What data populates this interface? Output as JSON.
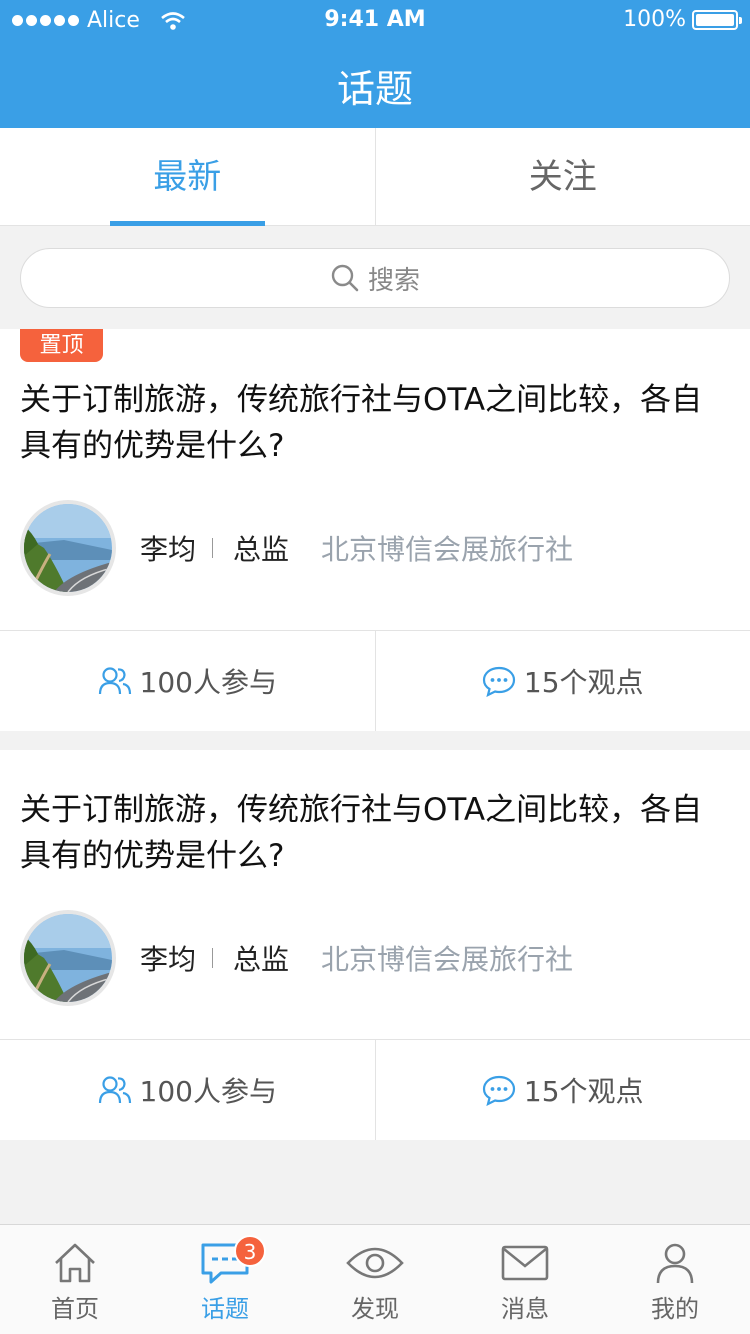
{
  "status_bar": {
    "carrier": "Alice",
    "time": "9:41 AM",
    "battery": "100%"
  },
  "nav": {
    "title": "话题"
  },
  "tabs": [
    {
      "label": "最新",
      "active": true
    },
    {
      "label": "关注",
      "active": false
    }
  ],
  "search": {
    "placeholder": "搜索"
  },
  "posts": [
    {
      "pinned_label": "置顶",
      "title": "关于订制旅游，传统旅行社与OTA之间比较，各自具有的优势是什么?",
      "author": {
        "name": "李均",
        "role": "总监",
        "company": "北京博信会展旅行社"
      },
      "participants": "100人参与",
      "opinions": "15个观点"
    },
    {
      "title": "关于订制旅游，传统旅行社与OTA之间比较，各自具有的优势是什么?",
      "author": {
        "name": "李均",
        "role": "总监",
        "company": "北京博信会展旅行社"
      },
      "participants": "100人参与",
      "opinions": "15个观点"
    }
  ],
  "tabbar": {
    "items": [
      {
        "label": "首页",
        "icon": "home-icon"
      },
      {
        "label": "话题",
        "icon": "chat-icon",
        "active": true,
        "badge": "3"
      },
      {
        "label": "发现",
        "icon": "eye-icon"
      },
      {
        "label": "消息",
        "icon": "mail-icon"
      },
      {
        "label": "我的",
        "icon": "user-icon"
      }
    ]
  },
  "colors": {
    "primary": "#3a9fe6",
    "accent": "#f5623d",
    "muted": "#9aa3ad"
  }
}
